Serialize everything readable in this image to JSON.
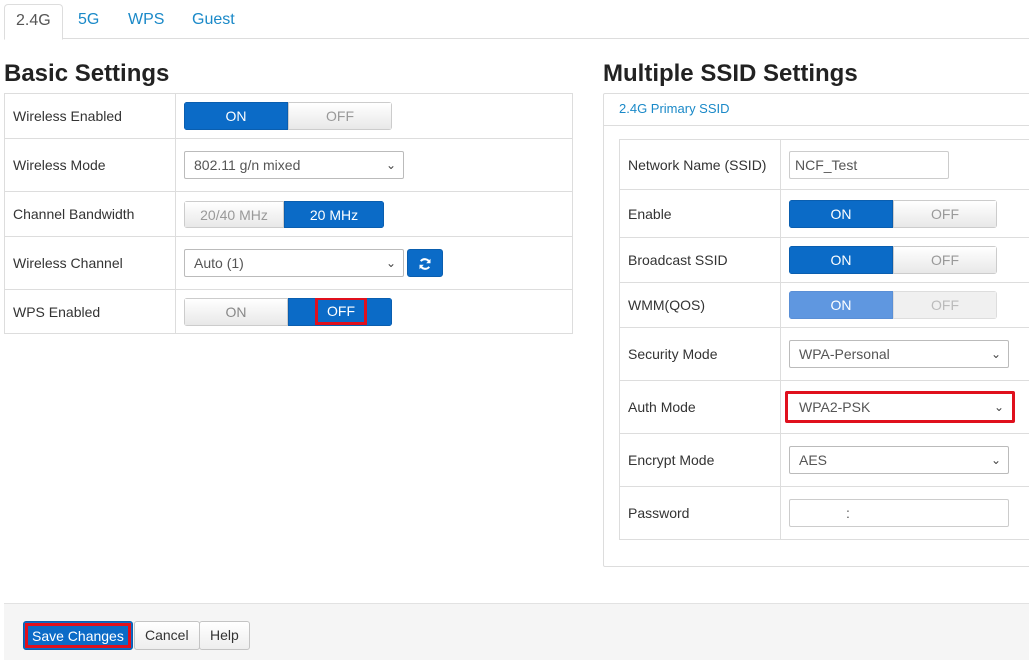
{
  "tabs": [
    "2.4G",
    "5G",
    "WPS",
    "Guest"
  ],
  "active_tab": "2.4G",
  "basic": {
    "title": "Basic Settings",
    "wireless_enabled": {
      "label": "Wireless Enabled",
      "on": "ON",
      "off": "OFF",
      "value": "ON"
    },
    "wireless_mode": {
      "label": "Wireless Mode",
      "value": "802.11 g/n mixed"
    },
    "channel_bandwidth": {
      "label": "Channel Bandwidth",
      "opt1": "20/40 MHz",
      "opt2": "20 MHz",
      "value": "20 MHz"
    },
    "wireless_channel": {
      "label": "Wireless Channel",
      "value": "Auto (1)",
      "refresh_icon": "refresh-icon"
    },
    "wps_enabled": {
      "label": "WPS Enabled",
      "on": "ON",
      "off": "OFF",
      "value": "OFF"
    }
  },
  "ssid": {
    "title": "Multiple SSID Settings",
    "panel_title": "2.4G Primary SSID",
    "network_name": {
      "label": "Network Name (SSID)",
      "value": "NCF_Test"
    },
    "enable": {
      "label": "Enable",
      "on": "ON",
      "off": "OFF",
      "value": "ON"
    },
    "broadcast": {
      "label": "Broadcast SSID",
      "on": "ON",
      "off": "OFF",
      "value": "ON"
    },
    "wmm": {
      "label": "WMM(QOS)",
      "on": "ON",
      "off": "OFF",
      "value": "ON",
      "disabled": true
    },
    "security_mode": {
      "label": "Security Mode",
      "value": "WPA-Personal"
    },
    "auth_mode": {
      "label": "Auth Mode",
      "value": "WPA2-PSK"
    },
    "encrypt_mode": {
      "label": "Encrypt Mode",
      "value": "AES"
    },
    "password": {
      "label": "Password",
      "value": ":"
    }
  },
  "footer": {
    "save": "Save Changes",
    "cancel": "Cancel",
    "help": "Help"
  },
  "colors": {
    "accent": "#0b6bc7",
    "link": "#1a89c8",
    "highlight": "#e0101d"
  }
}
